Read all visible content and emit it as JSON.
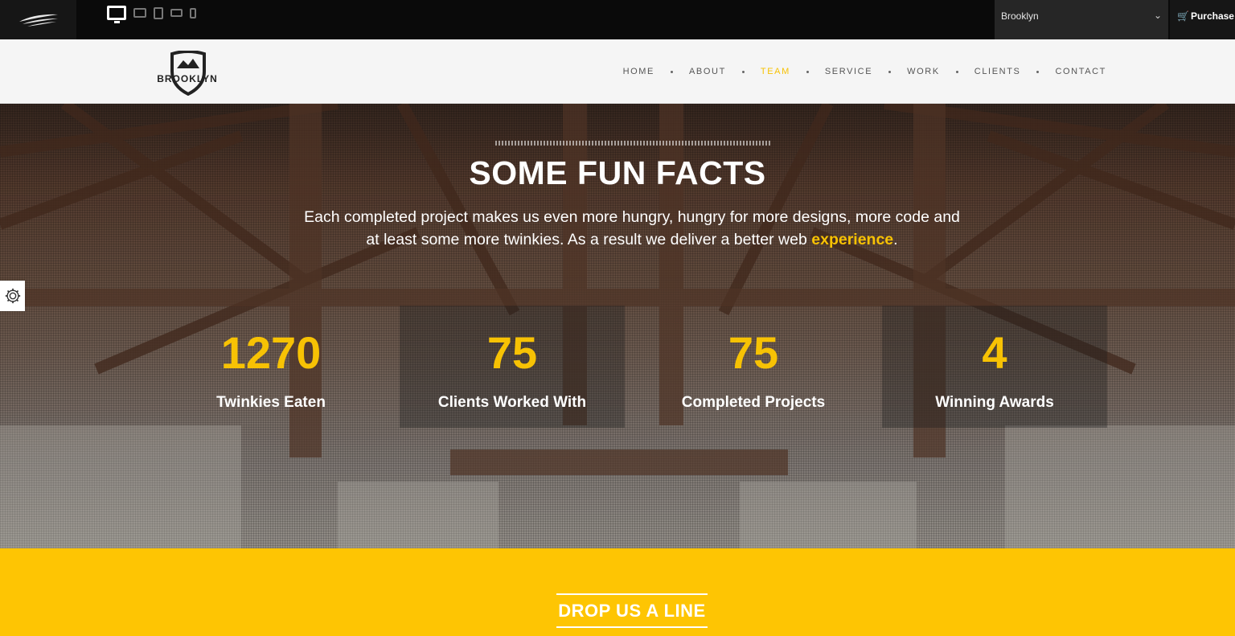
{
  "topbar": {
    "logo_icon": "wing-logo-icon",
    "devices": [
      "desktop-icon",
      "laptop-icon",
      "tablet-icon",
      "tablet-landscape-icon",
      "phone-icon"
    ],
    "theme_select": {
      "value": "Brooklyn"
    },
    "purchase_label": "Purchase"
  },
  "header": {
    "brand_name": "BROOKLYN",
    "nav": [
      {
        "label": "HOME",
        "active": false
      },
      {
        "label": "ABOUT",
        "active": false
      },
      {
        "label": "TEAM",
        "active": true
      },
      {
        "label": "SERVICE",
        "active": false
      },
      {
        "label": "WORK",
        "active": false
      },
      {
        "label": "CLIENTS",
        "active": false
      },
      {
        "label": "CONTACT",
        "active": false
      }
    ]
  },
  "facts": {
    "title": "SOME FUN FACTS",
    "text_before": "Each completed project makes us even more hungry, hungry for more designs, more code and at least some more twinkies. As a result we deliver a better web ",
    "text_highlight": "experience",
    "text_after": ".",
    "stats": [
      {
        "number": "1270",
        "label": "Twinkies Eaten"
      },
      {
        "number": "75",
        "label": "Clients Worked With"
      },
      {
        "number": "75",
        "label": "Completed Projects"
      },
      {
        "number": "4",
        "label": "Winning Awards"
      }
    ]
  },
  "contact": {
    "title": "DROP US A LINE"
  },
  "colors": {
    "accent": "#f7c204",
    "contact_bg": "#fec503"
  }
}
